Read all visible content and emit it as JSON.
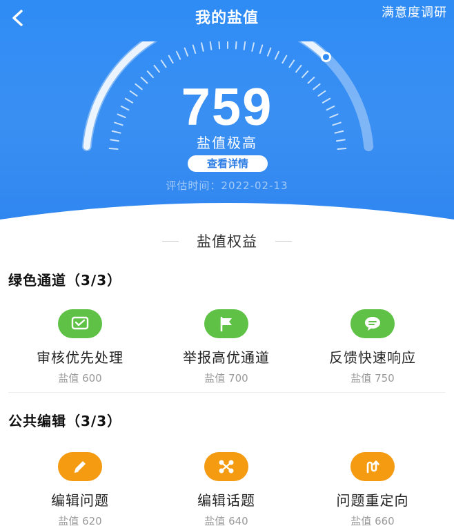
{
  "header": {
    "title": "我的盐值",
    "survey_label": "满意度调研",
    "score": "759",
    "level": "盐值极高",
    "detail_label": "查看详情",
    "eval_time": "评估时间：2022-02-13",
    "gauge_fraction": 0.759
  },
  "rights_title": "盐值权益",
  "groups": [
    {
      "title": "绿色通道（3/3）",
      "items": [
        {
          "name": "审核优先处理",
          "value": "盐值 600",
          "icon": "check-chat-icon"
        },
        {
          "name": "举报高优通道",
          "value": "盐值 700",
          "icon": "flag-icon"
        },
        {
          "name": "反馈快速响应",
          "value": "盐值 750",
          "icon": "chat-icon"
        }
      ]
    },
    {
      "title": "公共编辑（3/3）",
      "items": [
        {
          "name": "编辑问题",
          "value": "盐值 620",
          "icon": "pencil-icon"
        },
        {
          "name": "编辑话题",
          "value": "盐值 640",
          "icon": "nodes-icon"
        },
        {
          "name": "问题重定向",
          "value": "盐值 660",
          "icon": "redirect-icon"
        }
      ]
    }
  ],
  "colors": {
    "header_blue": "#2f8cf5",
    "green": "#5fc246",
    "orange": "#f49b12"
  }
}
